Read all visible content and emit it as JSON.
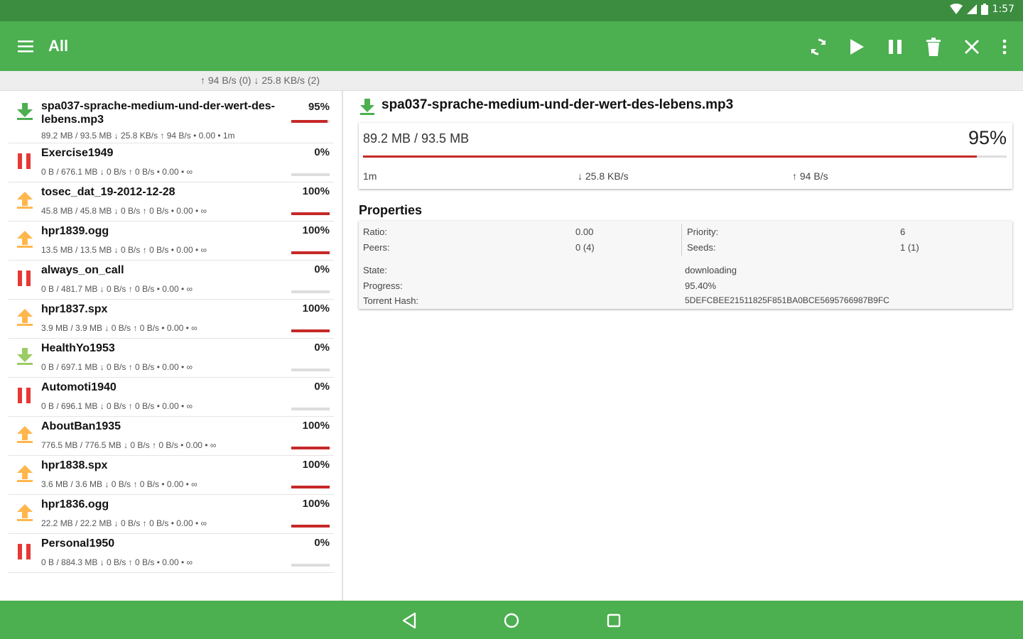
{
  "status_bar": {
    "time": "1:57"
  },
  "app_bar": {
    "title": "All",
    "icons": [
      "menu-icon",
      "refresh-icon",
      "play-icon",
      "pause-icon",
      "trash-icon",
      "close-icon",
      "more-vert-icon"
    ]
  },
  "speed_summary": "↑ 94 B/s (0) ↓ 25.8 KB/s (2)",
  "torrents": [
    {
      "name": "spa037-sprache-medium-und-der-wert-des-lebens.mp3",
      "percent": "95%",
      "progress": 0.95,
      "details": "89.2 MB / 93.5 MB ↓ 25.8 KB/s ↑ 94 B/s • 0.00 • 1m",
      "state": "downloading",
      "icon": "download-arrow-icon"
    },
    {
      "name": "Exercise1949",
      "percent": "0%",
      "progress": 0,
      "details": "0 B / 676.1 MB ↓ 0 B/s ↑ 0 B/s • 0.00 • ∞",
      "state": "paused",
      "icon": "pause-icon"
    },
    {
      "name": "tosec_dat_19-2012-12-28",
      "percent": "100%",
      "progress": 1,
      "details": "45.8 MB / 45.8 MB ↓ 0 B/s ↑ 0 B/s • 0.00 • ∞",
      "state": "seeding",
      "icon": "upload-arrow-icon"
    },
    {
      "name": "hpr1839.ogg",
      "percent": "100%",
      "progress": 1,
      "details": "13.5 MB / 13.5 MB ↓ 0 B/s ↑ 0 B/s • 0.00 • ∞",
      "state": "seeding",
      "icon": "upload-arrow-icon"
    },
    {
      "name": "always_on_call",
      "percent": "0%",
      "progress": 0,
      "details": "0 B / 481.7 MB ↓ 0 B/s ↑ 0 B/s • 0.00 • ∞",
      "state": "paused",
      "icon": "pause-icon"
    },
    {
      "name": "hpr1837.spx",
      "percent": "100%",
      "progress": 1,
      "details": "3.9 MB / 3.9 MB ↓ 0 B/s ↑ 0 B/s • 0.00 • ∞",
      "state": "seeding",
      "icon": "upload-arrow-icon"
    },
    {
      "name": "HealthYo1953",
      "percent": "0%",
      "progress": 0,
      "details": "0 B / 697.1 MB ↓ 0 B/s ↑ 0 B/s • 0.00 • ∞",
      "state": "queued",
      "icon": "download-arrow-icon"
    },
    {
      "name": "Automoti1940",
      "percent": "0%",
      "progress": 0,
      "details": "0 B / 696.1 MB ↓ 0 B/s ↑ 0 B/s • 0.00 • ∞",
      "state": "paused",
      "icon": "pause-icon"
    },
    {
      "name": "AboutBan1935",
      "percent": "100%",
      "progress": 1,
      "details": "776.5 MB / 776.5 MB ↓ 0 B/s ↑ 0 B/s • 0.00 • ∞",
      "state": "seeding",
      "icon": "upload-arrow-icon"
    },
    {
      "name": "hpr1838.spx",
      "percent": "100%",
      "progress": 1,
      "details": "3.6 MB / 3.6 MB ↓ 0 B/s ↑ 0 B/s • 0.00 • ∞",
      "state": "seeding",
      "icon": "upload-arrow-icon"
    },
    {
      "name": "hpr1836.ogg",
      "percent": "100%",
      "progress": 1,
      "details": "22.2 MB / 22.2 MB ↓ 0 B/s ↑ 0 B/s • 0.00 • ∞",
      "state": "seeding",
      "icon": "upload-arrow-icon"
    },
    {
      "name": "Personal1950",
      "percent": "0%",
      "progress": 0,
      "details": "0 B / 884.3 MB ↓ 0 B/s ↑ 0 B/s • 0.00 • ∞",
      "state": "paused",
      "icon": "pause-icon"
    }
  ],
  "detail": {
    "title": "spa037-sprache-medium-und-der-wert-des-lebens.mp3",
    "size": "89.2 MB / 93.5 MB",
    "percent": "95%",
    "progress": 0.954,
    "eta": "1m",
    "download_speed": "↓ 25.8 KB/s",
    "upload_speed": "↑ 94 B/s"
  },
  "properties": {
    "title": "Properties",
    "ratio_label": "Ratio:",
    "ratio_value": "0.00",
    "peers_label": "Peers:",
    "peers_value": "0 (4)",
    "priority_label": "Priority:",
    "priority_value": "6",
    "seeds_label": "Seeds:",
    "seeds_value": "1 (1)",
    "state_label": "State:",
    "state_value": "downloading",
    "progress_label": "Progress:",
    "progress_value": "95.40%",
    "hash_label": "Torrent Hash:",
    "hash_value": "5DEFCBEE21511825F851BA0BCE5695766987B9FC"
  },
  "colors": {
    "primary": "#4caf50",
    "primary_dark": "#3c8d40",
    "progress_red": "#c62828",
    "download_green": "#4caf50",
    "download_light_green": "#9ccc65",
    "upload_orange": "#ffb74d",
    "pause_red": "#e53935"
  },
  "nav_bar": {
    "icons": [
      "back-icon",
      "home-icon",
      "recents-icon"
    ]
  }
}
